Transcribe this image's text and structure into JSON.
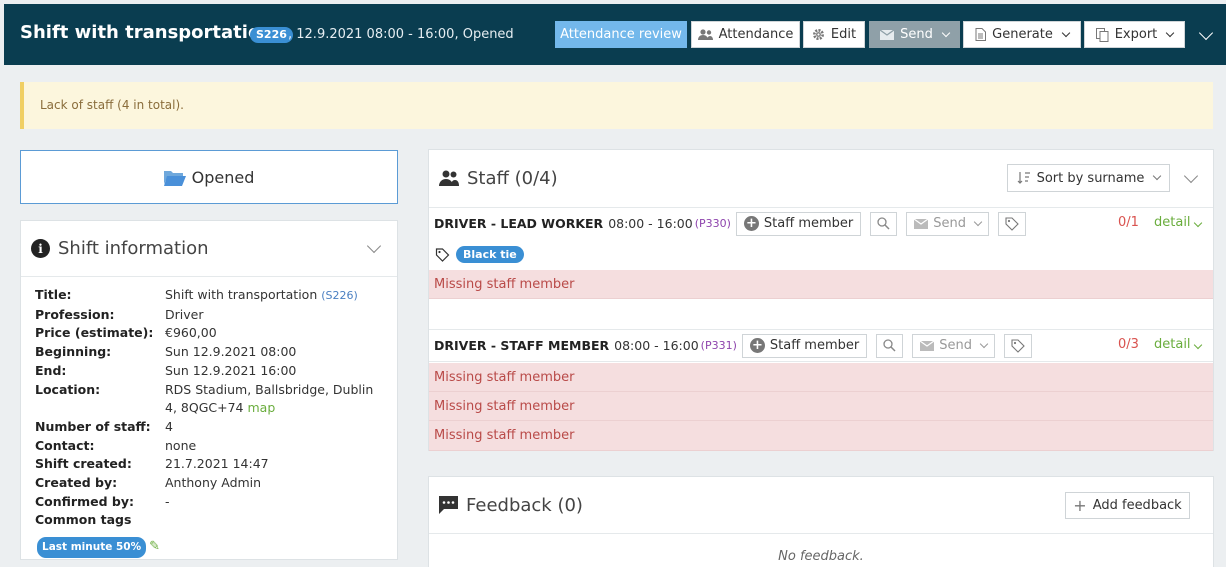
{
  "header": {
    "title": "Shift with transportation",
    "code": "S226",
    "subtitle": ", 12.9.2021 08:00 - 16:00, Opened",
    "buttons": {
      "attendance_review": "Attendance review",
      "attendance": "Attendance",
      "edit": "Edit",
      "send": "Send",
      "generate": "Generate",
      "export": "Export"
    }
  },
  "alert": {
    "text": "Lack of staff (4 in total)."
  },
  "status": {
    "label": "Opened"
  },
  "shift_info": {
    "heading": "Shift information",
    "rows": [
      {
        "label": "Title:",
        "value": "Shift with transportation",
        "code": "(S226)"
      },
      {
        "label": "Profession:",
        "value": "Driver"
      },
      {
        "label": "Price (estimate):",
        "value": "€960,00"
      },
      {
        "label": "Beginning:",
        "value": "Sun 12.9.2021 08:00"
      },
      {
        "label": "End:",
        "value": "Sun 12.9.2021 16:00"
      },
      {
        "label": "Location:",
        "value": "RDS Stadium, Ballsbridge, Dublin 4, 8QGC+74",
        "link": "map"
      },
      {
        "label": "Number of staff:",
        "value": "4"
      },
      {
        "label": "Contact:",
        "value": "none"
      },
      {
        "label": "Shift created:",
        "value": "21.7.2021 14:47"
      },
      {
        "label": "Created by:",
        "value": "Anthony Admin"
      },
      {
        "label": "Confirmed by:",
        "value": "-"
      },
      {
        "label": "Common tags",
        "value": ""
      }
    ],
    "tag": "Last minute 50%"
  },
  "staff": {
    "heading": "Staff (0/4)",
    "sort_label": "Sort by surname",
    "positions": [
      {
        "name": "DRIVER - LEAD WORKER",
        "time": "08:00 - 16:00",
        "code": "(P330)",
        "staff_button": "Staff member",
        "send": "Send",
        "count": "0/1",
        "detail": "detail",
        "tag": "Black tie",
        "missing": [
          "Missing staff member"
        ]
      },
      {
        "name": "DRIVER - STAFF MEMBER",
        "time": "08:00 - 16:00",
        "code": "(P331)",
        "staff_button": "Staff member",
        "send": "Send",
        "count": "0/3",
        "detail": "detail",
        "missing": [
          "Missing staff member",
          "Missing staff member",
          "Missing staff member"
        ]
      }
    ]
  },
  "feedback": {
    "heading": "Feedback (0)",
    "add_button": "Add feedback",
    "empty": "No feedback."
  },
  "colors": {
    "header_bg": "#0a3d50",
    "accent": "#3a8fd4",
    "alert_bg": "#fcf6dd",
    "missing_bg": "#f5dedf",
    "link_green": "#6aad3d"
  }
}
